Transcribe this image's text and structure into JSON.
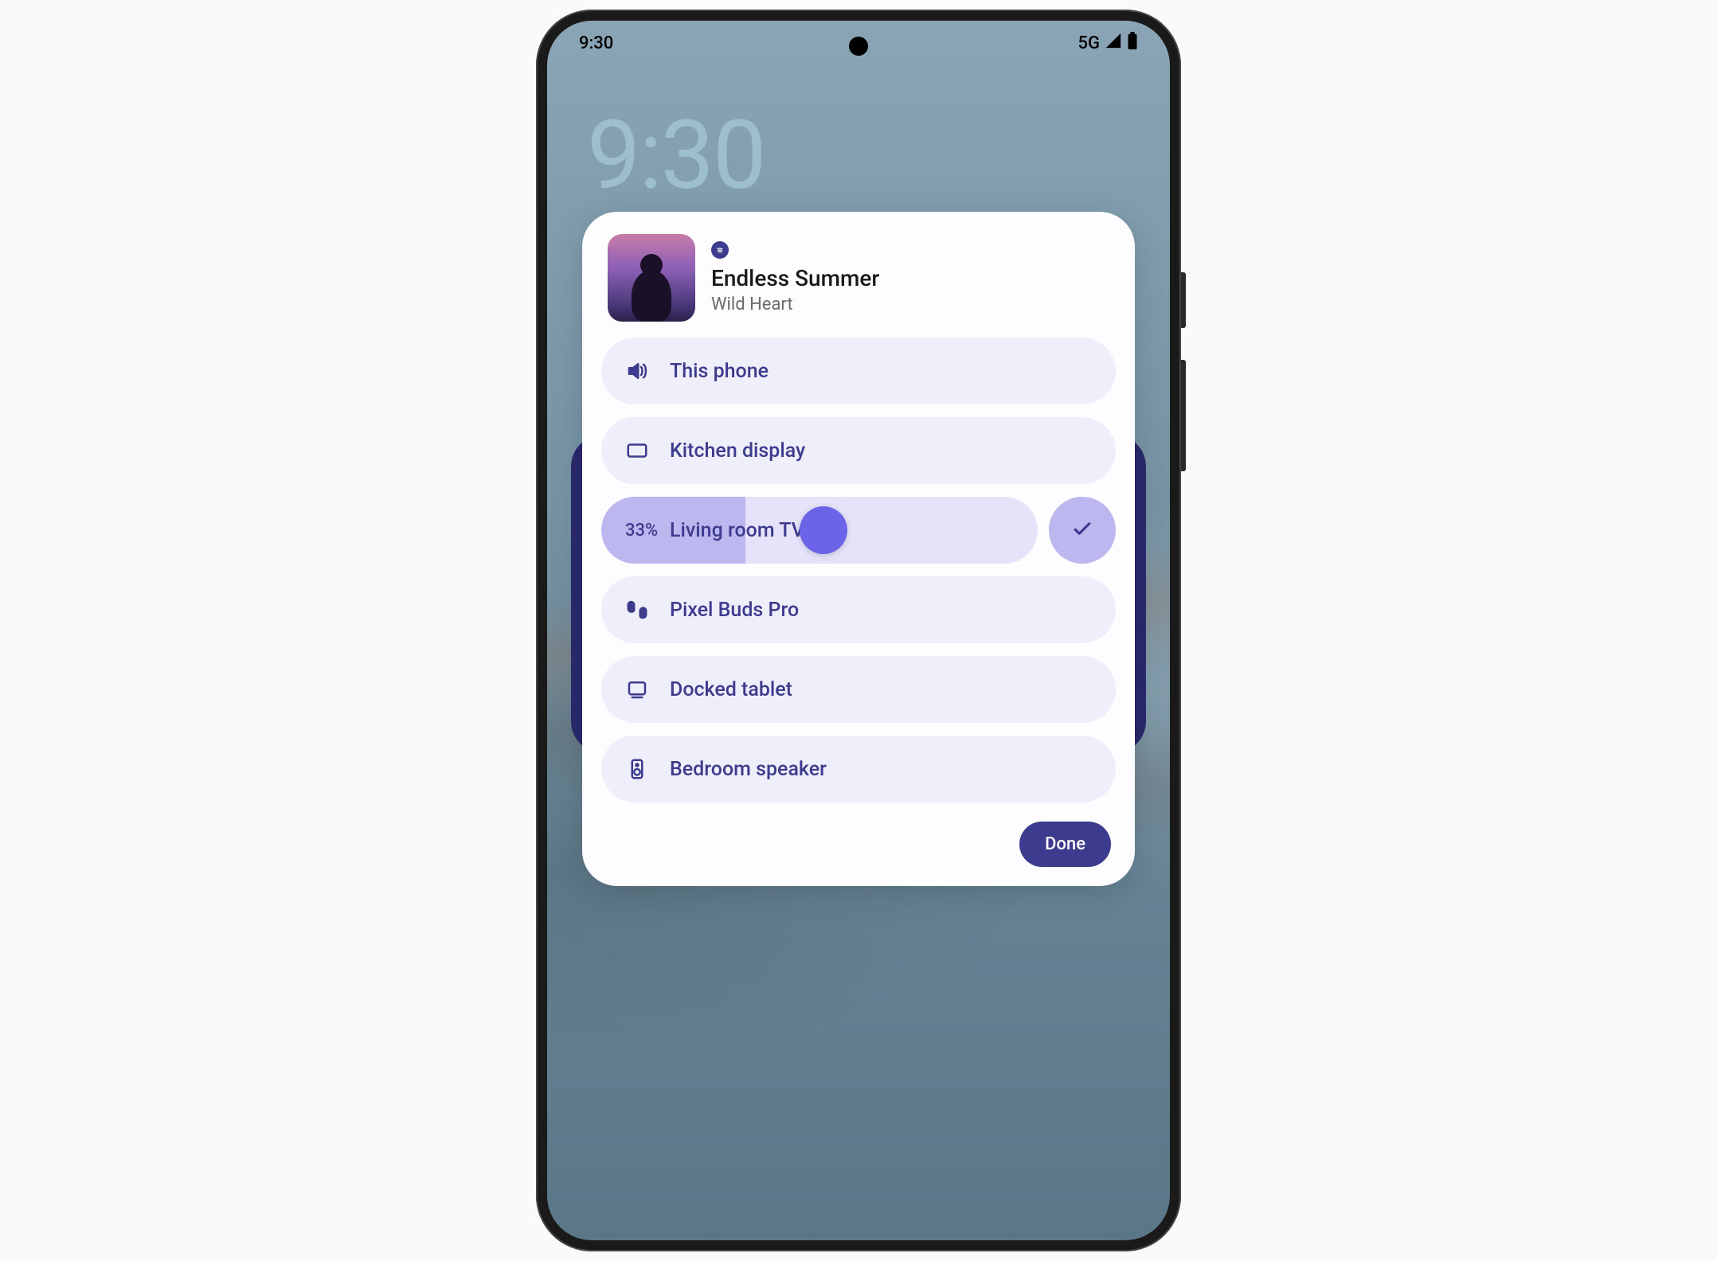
{
  "status_bar": {
    "time": "9:30",
    "network": "5G"
  },
  "lock_screen": {
    "clock": "9:30"
  },
  "media": {
    "source_icon": "spotify-icon",
    "title": "Endless Summer",
    "artist": "Wild Heart"
  },
  "devices": [
    {
      "icon": "volume-icon",
      "label": "This phone",
      "active": false
    },
    {
      "icon": "display-icon",
      "label": "Kitchen display",
      "active": false
    },
    {
      "icon": "tv-icon",
      "label": "Living room TV",
      "active": true,
      "volume_pct": "33%",
      "volume_value": 33
    },
    {
      "icon": "earbuds-icon",
      "label": "Pixel Buds Pro",
      "active": false
    },
    {
      "icon": "tablet-dock-icon",
      "label": "Docked tablet",
      "active": false
    },
    {
      "icon": "speaker-icon",
      "label": "Bedroom speaker",
      "active": false
    }
  ],
  "footer": {
    "done": "Done"
  },
  "colors": {
    "accent": "#3d3b8e",
    "chip_bg": "#efeefb",
    "chip_active": "#bdb7f0",
    "thumb": "#6b63e8"
  }
}
